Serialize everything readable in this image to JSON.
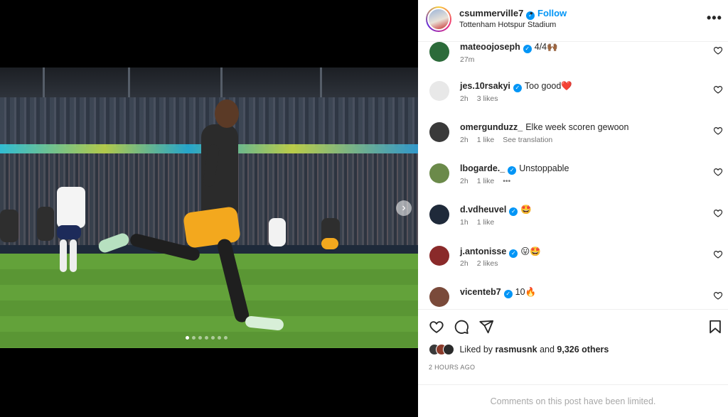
{
  "post": {
    "username": "csummerville7",
    "follow_label": "Follow",
    "separator": "•",
    "location": "Tottenham Hotspur Stadium",
    "more_label": "•••",
    "slide_count": 7,
    "active_slide": 1,
    "next_arrow": "›"
  },
  "comments": [
    {
      "user": "mateoojoseph",
      "verified": true,
      "text": "4/4🙌🏾",
      "time": "27m",
      "likes": "",
      "extra": "",
      "avatar_color": "#2c6b3a"
    },
    {
      "user": "jes.10rsakyi",
      "verified": true,
      "text": "Too good❤️",
      "time": "2h",
      "likes": "3 likes",
      "extra": "",
      "avatar_color": "#e8e8e8"
    },
    {
      "user": "omergunduzz_",
      "verified": false,
      "text": "Elke week scoren gewoon",
      "time": "2h",
      "likes": "1 like",
      "extra": "See translation",
      "avatar_color": "#3a3a3a"
    },
    {
      "user": "lbogarde._",
      "verified": true,
      "text": "Unstoppable",
      "time": "2h",
      "likes": "1 like",
      "extra": "•••",
      "avatar_color": "#6b8a4a"
    },
    {
      "user": "d.vdheuvel",
      "verified": true,
      "text": "🤩",
      "time": "1h",
      "likes": "1 like",
      "extra": "",
      "avatar_color": "#1f2a3a"
    },
    {
      "user": "j.antonisse",
      "verified": true,
      "text": "😛🤩",
      "time": "2h",
      "likes": "2 likes",
      "extra": "",
      "avatar_color": "#8a2a2a"
    },
    {
      "user": "vicenteb7",
      "verified": true,
      "text": "10🔥",
      "time": "",
      "likes": "",
      "extra": "",
      "avatar_color": "#7a4a3a"
    }
  ],
  "likes": {
    "prefix": "Liked by",
    "user": "rasmusnk",
    "middle": "and",
    "count": "9,326 others"
  },
  "timestamp": "2 HOURS AGO",
  "limited_notice": "Comments on this post have been limited.",
  "colors": {
    "accent": "#0095f6",
    "text": "#262626",
    "secondary": "#737373"
  }
}
